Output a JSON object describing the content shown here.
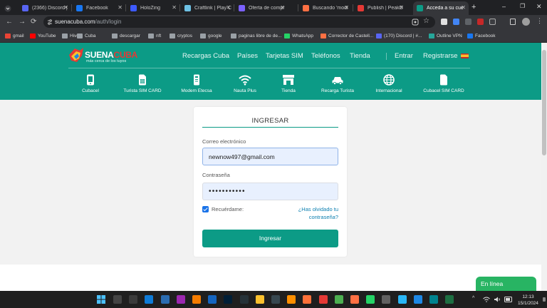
{
  "browser": {
    "tabs": [
      {
        "label": "(2366) Discord | ",
        "color": "#5865f2"
      },
      {
        "label": "Facebook",
        "color": "#1877f2"
      },
      {
        "label": "HoloZing",
        "color": "#3d5afe"
      },
      {
        "label": "Craftlink | Play C",
        "color": "#6ec1e4"
      },
      {
        "label": "Oferta de compr",
        "color": "#7b61ff"
      },
      {
        "label": "Buscando 'modi",
        "color": "#ff7043"
      },
      {
        "label": "Publish | PeakD",
        "color": "#e53935"
      },
      {
        "label": "Acceda a su cue",
        "color": "#0c9b86"
      }
    ],
    "url_host": "suenacuba.com",
    "url_path": "/auth/login",
    "bookmarks": [
      {
        "label": "gmail",
        "color": "#ea4335"
      },
      {
        "label": "YouTube",
        "color": "#ff0000"
      },
      {
        "label": "Hive",
        "color": "#9aa0a6"
      },
      {
        "label": "Cuba",
        "color": "#9aa0a6"
      },
      {
        "label": "descargar",
        "color": "#9aa0a6"
      },
      {
        "label": "nft",
        "color": "#9aa0a6"
      },
      {
        "label": "cryptos",
        "color": "#9aa0a6"
      },
      {
        "label": "google",
        "color": "#9aa0a6"
      },
      {
        "label": "paginas libre de de...",
        "color": "#9aa0a6"
      },
      {
        "label": "WhatsApp",
        "color": "#25d366"
      },
      {
        "label": "Corrector de Castell...",
        "color": "#ff7043"
      },
      {
        "label": "(170) Discord | #...",
        "color": "#5865f2"
      },
      {
        "label": "Outline VPN",
        "color": "#26a69a"
      },
      {
        "label": "Facebook",
        "color": "#1877f2"
      }
    ]
  },
  "site": {
    "logo_part1": "SUENA",
    "logo_part2": "CUBA",
    "tagline": "más cerca de los tuyos",
    "nav": [
      "Recargas Cuba",
      "Países",
      "Tarjetas SIM",
      "Teléfonos",
      "Tienda",
      "Entrar",
      "Registrarse"
    ],
    "categories": [
      {
        "label": "Cubacel",
        "icon": "phone-icon"
      },
      {
        "label": "Turista SIM CARD",
        "icon": "sim-card-icon"
      },
      {
        "label": "Modem Etecsa",
        "icon": "modem-icon"
      },
      {
        "label": "Nauta Plus",
        "icon": "wifi-icon"
      },
      {
        "label": "Tienda",
        "icon": "store-icon"
      },
      {
        "label": "Recarga Turista",
        "icon": "car-icon"
      },
      {
        "label": "Internacional",
        "icon": "globe-icon"
      },
      {
        "label": "Cubacel SIM CARD",
        "icon": "sim-card-icon"
      }
    ],
    "accent": "#0c9b86"
  },
  "login": {
    "title": "INGRESAR",
    "email_label": "Correo electrónico",
    "email_value": "newnow497@gmail.com",
    "password_label": "Contraseña",
    "password_value": "•••••••••••",
    "remember_label": "Recuérdame:",
    "remember_checked": true,
    "forgot_label": "¿Has olvidado tu contraseña?",
    "submit_label": "Ingresar"
  },
  "chat": {
    "label": "En línea"
  },
  "taskbar": {
    "time": "12:13",
    "date": "15/1/2024",
    "tray_chevron": "^"
  }
}
